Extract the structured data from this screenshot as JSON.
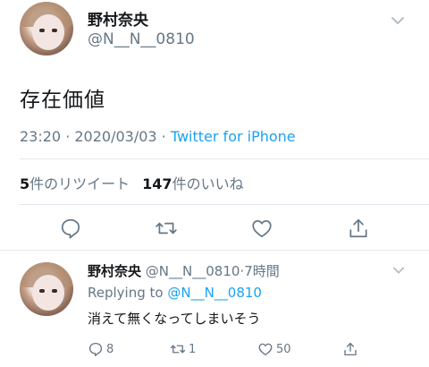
{
  "main_tweet": {
    "author_name": "野村奈央",
    "author_handle": "@N__N__0810",
    "text": "存在価値",
    "timestamp": "23:20 · 2020/03/03 · ",
    "client": "Twitter for iPhone",
    "retweet_count": "5",
    "retweet_label": "件のリツイート",
    "like_count": "147",
    "like_label": "件のいいね",
    "actions": [
      "reply-icon",
      "retweet-icon",
      "like-icon",
      "share-icon"
    ]
  },
  "reply_tweet": {
    "author_name": "野村奈央",
    "author_handle": "@N__N__0810",
    "dot": "·",
    "time": "7時間",
    "replying_prefix": "Replying to ",
    "replying_to": "@N__N__0810",
    "text": "消えて無くなってしまいそう",
    "reply_count": "8",
    "retweet_count": "1",
    "like_count": "50"
  },
  "colors": {
    "accent": "#1da1f2",
    "secondary_text": "#657786",
    "primary_text": "#14171a",
    "divider": "#e1e8ed"
  }
}
